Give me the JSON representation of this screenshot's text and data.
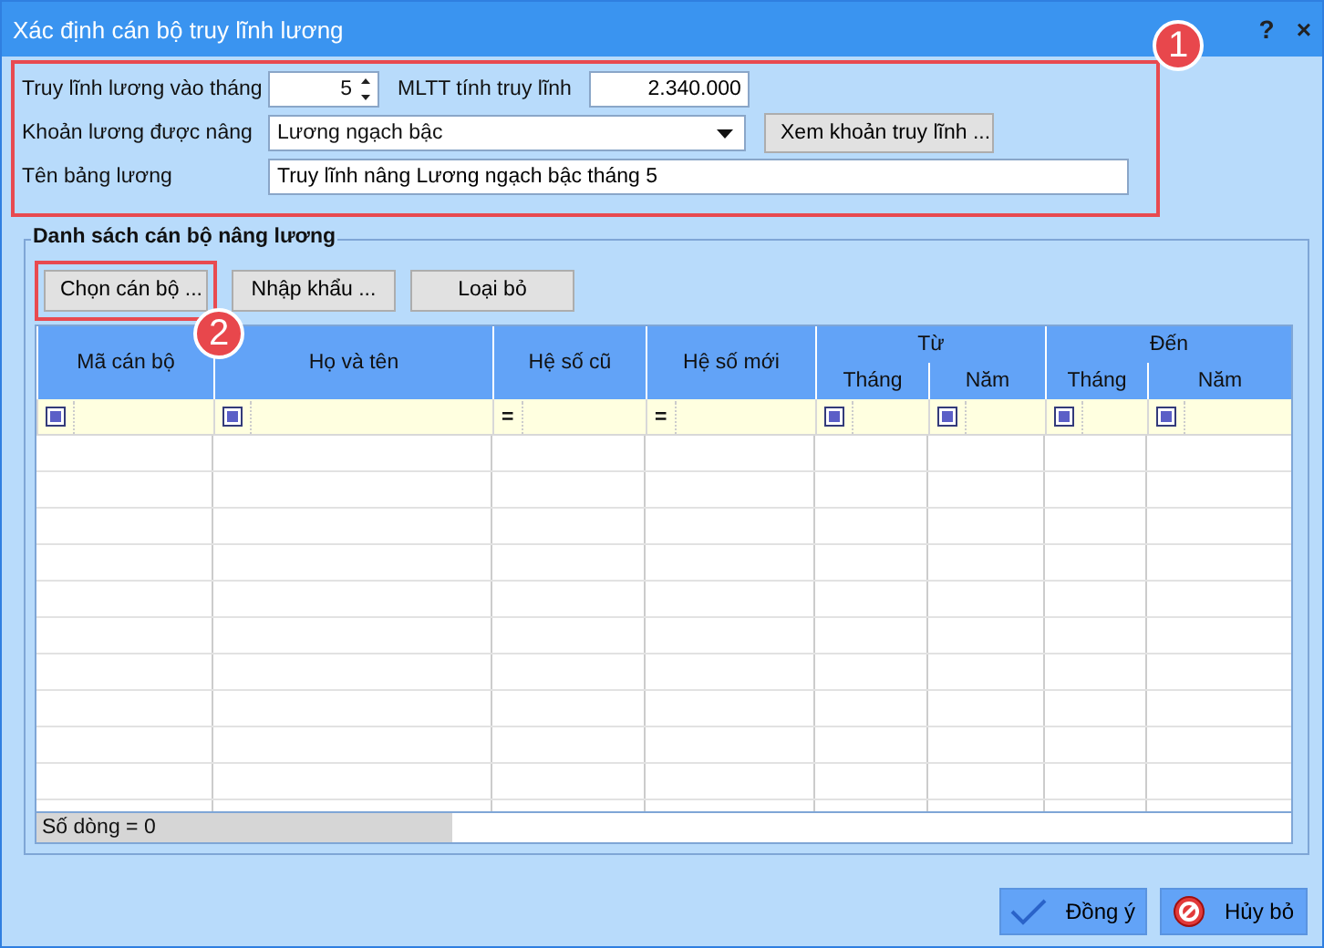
{
  "window": {
    "title": "Xác định cán bộ truy lĩnh lương",
    "controls": [
      "?",
      "×"
    ]
  },
  "form": {
    "month": {
      "label": "Truy lĩnh lương vào tháng",
      "value": "5"
    },
    "base_salary": {
      "label": "MLTT tính truy lĩnh",
      "value": "2.340.000"
    },
    "salary_item": {
      "label": "Khoản lương được nâng",
      "value": "Lương ngạch bậc",
      "button": "Xem khoản truy lĩnh ..."
    },
    "sheet_name": {
      "label": "Tên bảng lương",
      "value": "Truy lĩnh nâng Lương ngạch bậc tháng 5"
    }
  },
  "group": {
    "title": "Danh sách cán bộ nâng lương",
    "buttons": [
      "Chọn cán bộ ...",
      "Nhập khẩu ...",
      "Loại bỏ"
    ],
    "table": {
      "columns": [
        {
          "label": "Mã cán bộ"
        },
        {
          "label": "Họ và tên"
        },
        {
          "label": "Hệ số cũ"
        },
        {
          "label": "Hệ số mới"
        },
        {
          "label": "Từ",
          "children": [
            {
              "label": "Tháng"
            },
            {
              "label": "Năm"
            }
          ]
        },
        {
          "label": "Đến",
          "children": [
            {
              "label": "Tháng"
            },
            {
              "label": "Năm"
            }
          ]
        }
      ],
      "filter_row": [
        {
          "kind": "box"
        },
        {
          "kind": "box"
        },
        {
          "kind": "equals",
          "symbol": "="
        },
        {
          "kind": "equals",
          "symbol": "="
        },
        {
          "kind": "box"
        },
        {
          "kind": "box"
        },
        {
          "kind": "box"
        },
        {
          "kind": "box"
        }
      ],
      "status": "Số dòng = 0"
    }
  },
  "callouts": [
    {
      "label": "1"
    },
    {
      "label": "2"
    }
  ],
  "footer_buttons": [
    {
      "kind": "ok",
      "label": "Đồng ý"
    },
    {
      "kind": "cancel",
      "label": "Hủy bỏ"
    }
  ]
}
